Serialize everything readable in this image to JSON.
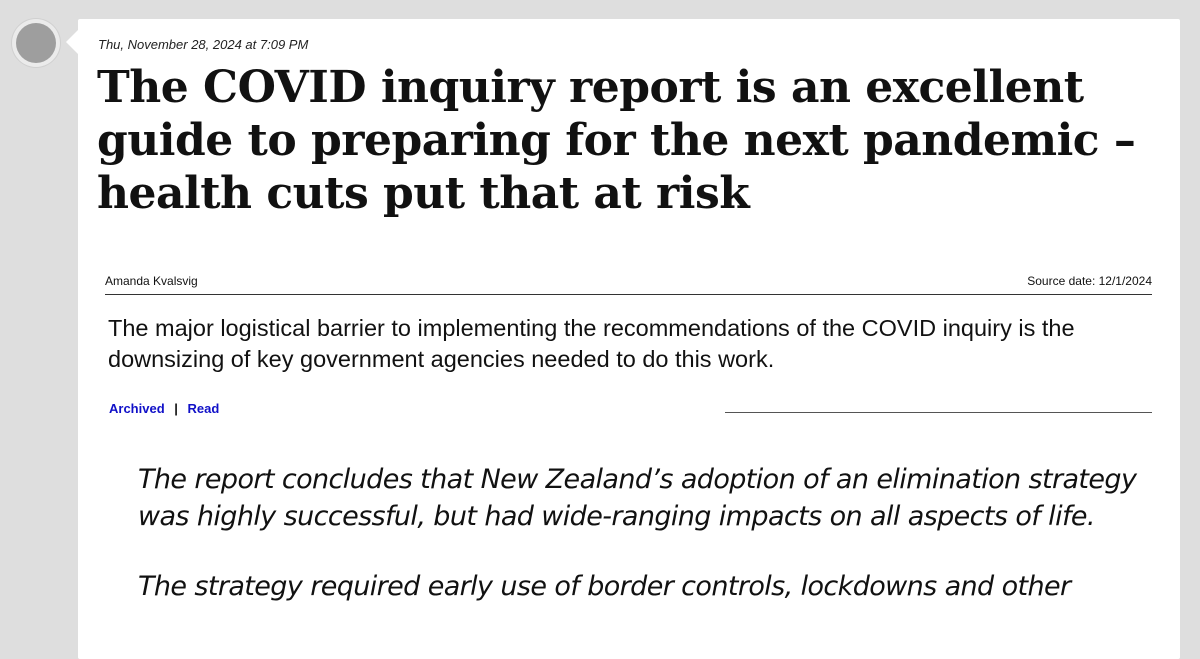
{
  "post": {
    "date": "Thu, November 28, 2024 at 7:09 PM",
    "headline": "The COVID inquiry report is an excellent guide to preparing for the next pandemic – health cuts put that at risk",
    "author": "Amanda Kvalsvig",
    "source_date": "Source date: 12/1/2024",
    "summary": "The major logistical barrier to implementing the recommendations of the COVID inquiry is the downsizing of key government agencies needed to do this work.",
    "links": {
      "archived": "Archived",
      "separator": "|",
      "read": "Read"
    },
    "quote_paragraphs": [
      "The report concludes that New Zealand’s adoption of an elimination strategy was highly successful, but had wide-ranging impacts on all aspects of life.",
      "The strategy required early use of border controls, lockdowns and other"
    ]
  },
  "colors": {
    "background": "#dedede",
    "card": "#ffffff",
    "link": "#1010c8",
    "avatar": "#9e9e9e"
  }
}
